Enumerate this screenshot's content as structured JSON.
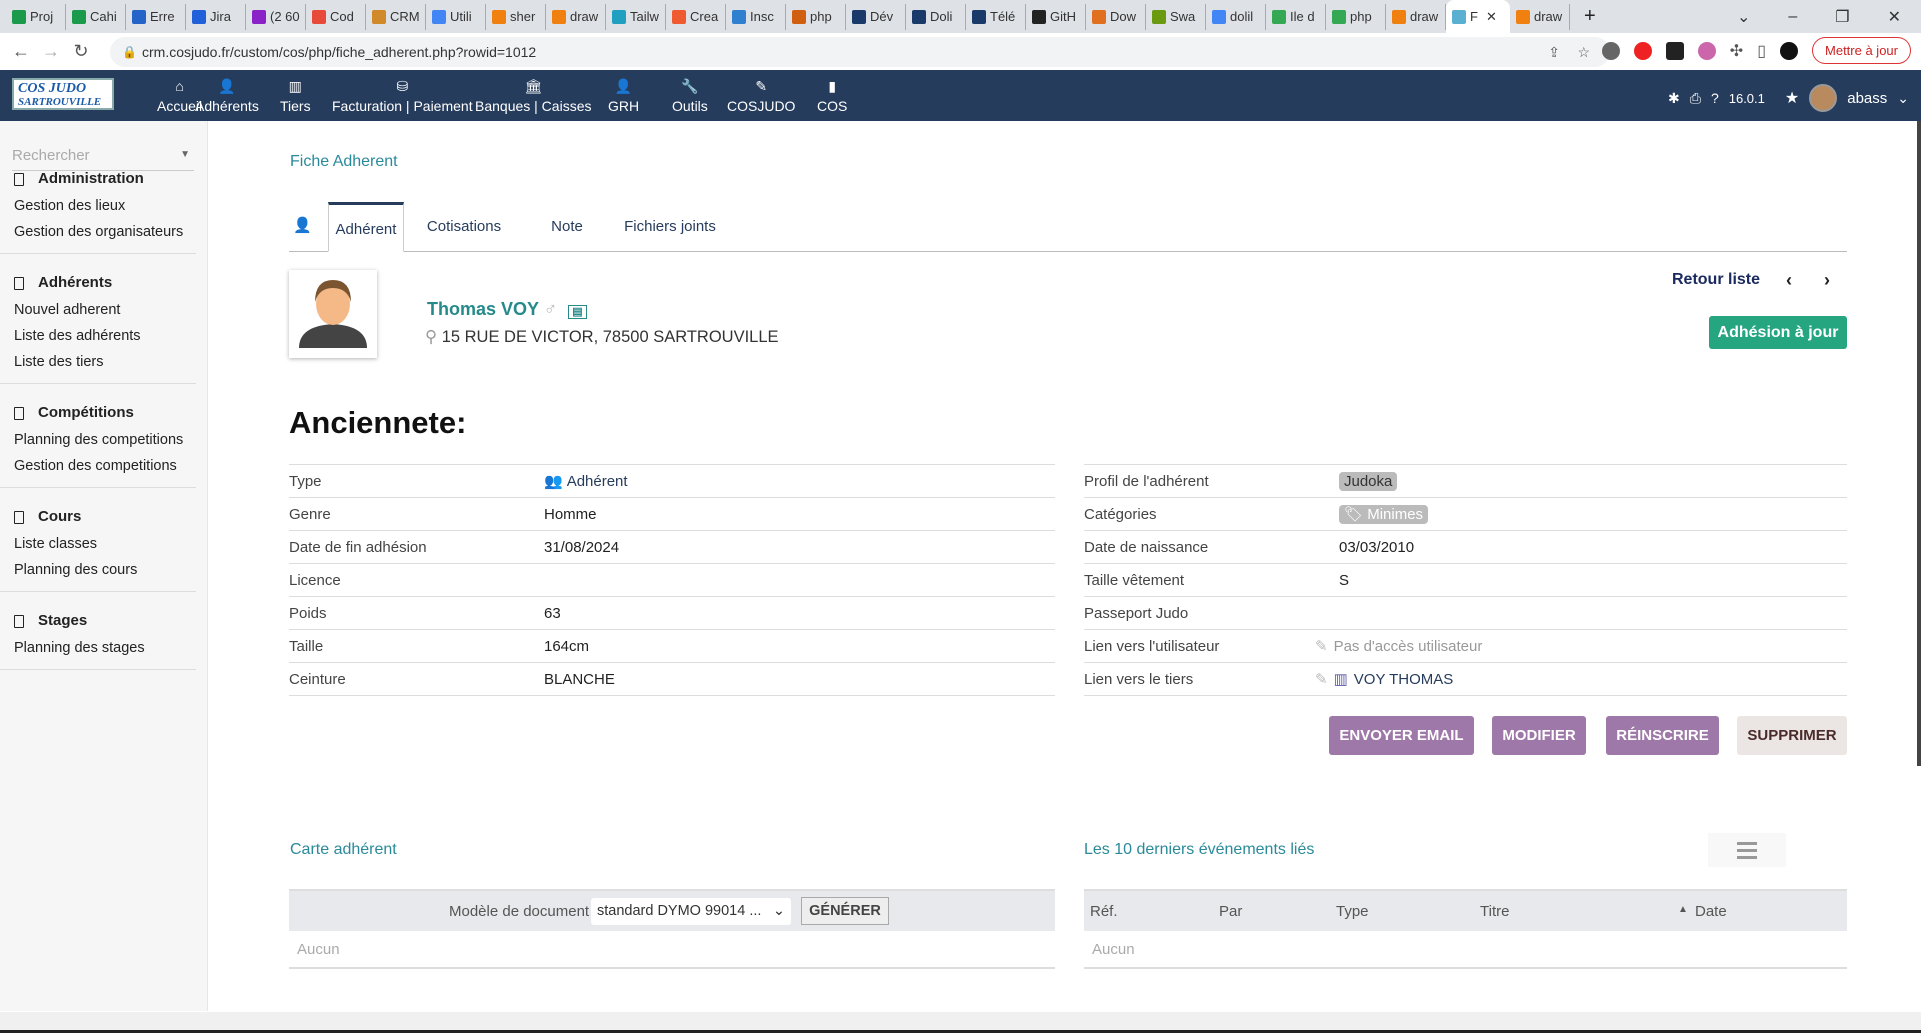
{
  "browser": {
    "tabs": [
      "Proj",
      "Cahi",
      "Erre",
      "Jira",
      "(2 60",
      "Cod",
      "CRM",
      "Utili",
      "sher",
      "draw",
      "Tailw",
      "Crea",
      "Insc",
      "php",
      "Dév",
      "Doli",
      "Télé",
      "GitH",
      "Dow",
      "Swa",
      "dolil",
      "Ile d",
      "php",
      "draw",
      "F",
      "draw"
    ],
    "tab_colors": [
      "#1a9a4a",
      "#1a9a4a",
      "#2464c8",
      "#2060d8",
      "#8a22c8",
      "#e84a3a",
      "#d08a2a",
      "#4285f4",
      "#f08010",
      "#f08010",
      "#20a0c0",
      "#f05a30",
      "#3080d0",
      "#d06010",
      "#1a3a6a",
      "#1a3a6a",
      "#1a3a6a",
      "#222",
      "#e07020",
      "#6a9a10",
      "#4285f4",
      "#34a853",
      "#34a853",
      "#f08010",
      "#5ab0d0",
      "#f08010"
    ],
    "active_tab_index": 24,
    "new_tab": "+",
    "url": "crm.cosjudo.fr/custom/cos/php/fiche_adherent.php?rowid=1012",
    "update_button": "Mettre à jour"
  },
  "topnav": {
    "logo": "COS JUDO SARTROUVILLE",
    "menus": [
      {
        "label": "Accueil",
        "icon": "⌂"
      },
      {
        "label": "Adhérents",
        "icon": "👤"
      },
      {
        "label": "Tiers",
        "icon": "▥"
      },
      {
        "label": "Facturation | Paiement",
        "icon": "⛁"
      },
      {
        "label": "Banques | Caisses",
        "icon": "🏛"
      },
      {
        "label": "GRH",
        "icon": "👤"
      },
      {
        "label": "Outils",
        "icon": "🔧"
      },
      {
        "label": "COSJUDO",
        "icon": "✎"
      },
      {
        "label": "COS",
        "icon": "▮"
      }
    ],
    "version": "16.0.1",
    "user": "abass"
  },
  "sidebar": {
    "search_placeholder": "Rechercher",
    "groups": [
      {
        "title": "Administration",
        "items": [
          "Gestion des lieux",
          "Gestion des organisateurs"
        ]
      },
      {
        "title": "Adhérents",
        "items": [
          "Nouvel adherent",
          "Liste des adhérents",
          "Liste des tiers"
        ]
      },
      {
        "title": "Compétitions",
        "items": [
          "Planning des competitions",
          "Gestion des competitions"
        ]
      },
      {
        "title": "Cours",
        "items": [
          "Liste classes",
          "Planning des cours"
        ]
      },
      {
        "title": "Stages",
        "items": [
          "Planning des stages"
        ]
      }
    ]
  },
  "page": {
    "breadcrumb": "Fiche Adherent",
    "tabs": [
      "Adhérent",
      "Cotisations",
      "Note",
      "Fichiers joints"
    ],
    "name": "Thomas VOY",
    "gender_symbol": "♂",
    "address": "15 RUE DE VICTOR, 78500 SARTROUVILLE",
    "back_to_list": "Retour liste",
    "status_button": "Adhésion à jour",
    "heading": "Anciennete:",
    "left_fields": [
      {
        "label": "Type",
        "value": "Adhérent"
      },
      {
        "label": "Genre",
        "value": "Homme"
      },
      {
        "label": "Date de fin adhésion",
        "value": "31/08/2024"
      },
      {
        "label": "Licence",
        "value": ""
      },
      {
        "label": "Poids",
        "value": "63"
      },
      {
        "label": "Taille",
        "value": "164cm"
      },
      {
        "label": "Ceinture",
        "value": "BLANCHE"
      }
    ],
    "right_fields": [
      {
        "label": "Profil de l'adhérent",
        "value": "Judoka"
      },
      {
        "label": "Catégories",
        "value": "Minimes"
      },
      {
        "label": "Date de naissance",
        "value": "03/03/2010"
      },
      {
        "label": "Taille vêtement",
        "value": "S"
      },
      {
        "label": "Passeport Judo",
        "value": ""
      },
      {
        "label": "Lien vers l'utilisateur",
        "value": "Pas d'accès utilisateur"
      },
      {
        "label": "Lien vers le tiers",
        "value": "VOY THOMAS"
      }
    ],
    "actions": [
      "ENVOYER EMAIL",
      "MODIFIER",
      "RÉINSCRIRE",
      "SUPPRIMER"
    ],
    "card_section": {
      "title": "Carte adhérent",
      "model_label": "Modèle de document",
      "model_value": "standard DYMO 99014 ...",
      "generate": "GÉNÉRER",
      "empty": "Aucun"
    },
    "events_section": {
      "title": "Les 10 derniers événements liés",
      "columns": [
        "Réf.",
        "Par",
        "Type",
        "Titre",
        "Date"
      ],
      "sort_indicator": "▲",
      "empty": "Aucun"
    }
  }
}
